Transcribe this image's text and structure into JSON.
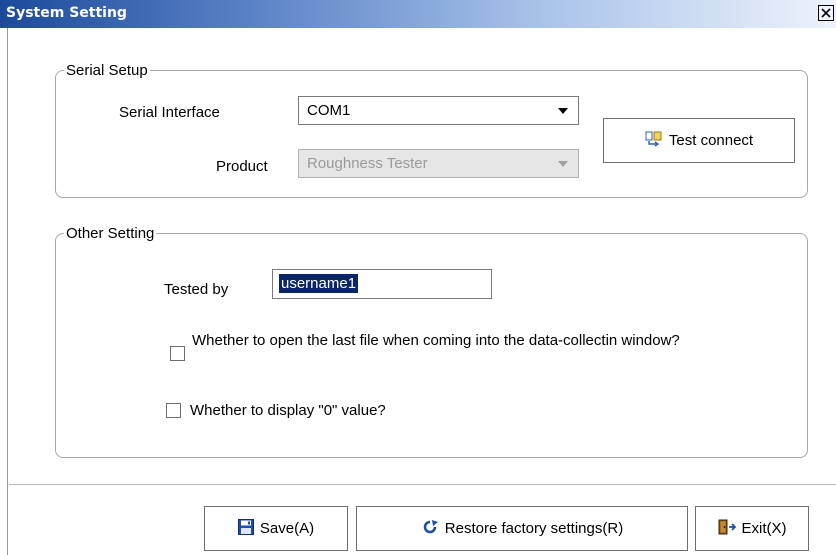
{
  "window": {
    "title": "System Setting",
    "close_glyph": "✕"
  },
  "serial_setup": {
    "group_label": "Serial Setup",
    "serial_interface_label": "Serial Interface",
    "serial_interface_value": "COM1",
    "product_label": "Product",
    "product_value": "Roughness Tester",
    "test_connect_label": "Test connect",
    "test_connect_icon": "connect-icon"
  },
  "other_setting": {
    "group_label": "Other Setting",
    "tested_by_label": "Tested by",
    "tested_by_value": "username1",
    "open_last_file_label": "Whether to open the last file when coming into the data-collectin window?",
    "open_last_file_checked": false,
    "display_zero_label": "Whether to display \"0\" value?",
    "display_zero_checked": false
  },
  "footer": {
    "save_label": "Save(A)",
    "save_icon": "floppy-disk-icon",
    "restore_label": "Restore factory settings(R)",
    "restore_icon": "refresh-icon",
    "exit_label": "Exit(X)",
    "exit_icon": "door-exit-icon"
  },
  "colors": {
    "titlebar_start": "#1c4a9a",
    "titlebar_end": "#eef3fb",
    "selection": "#0a246a"
  }
}
